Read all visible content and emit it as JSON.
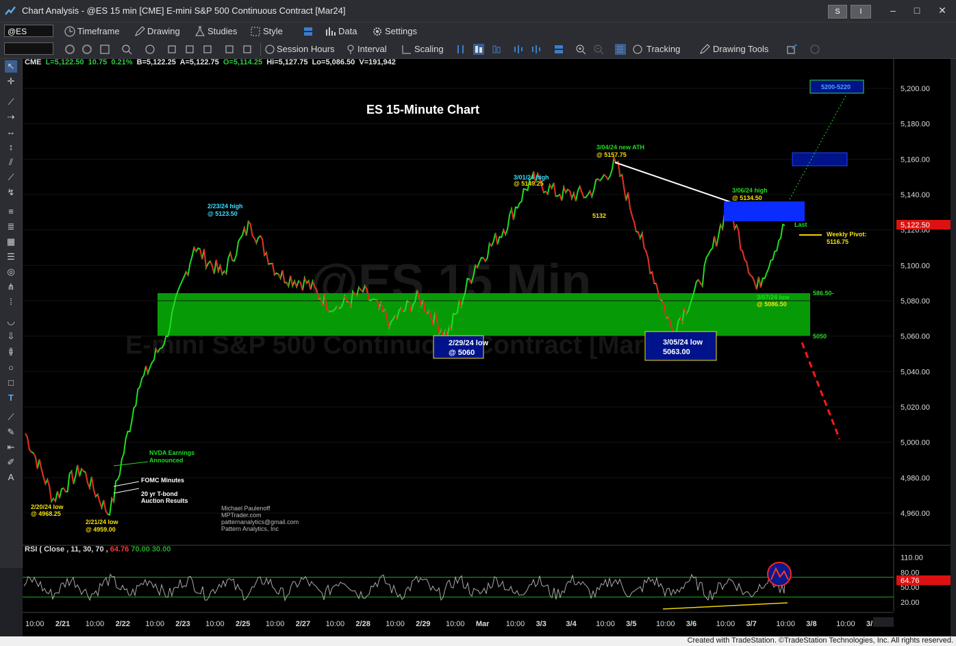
{
  "window": {
    "title": "Chart Analysis - @ES 15 min [CME] E-mini S&P 500 Continuous Contract [Mar24]",
    "btn_s": "S",
    "btn_i": "I",
    "ctl_min": "–",
    "ctl_max": "□",
    "ctl_close": "✕"
  },
  "toolbar1": {
    "symbol": "@ES",
    "timeframe": "Timeframe",
    "drawing": "Drawing",
    "studies": "Studies",
    "style": "Style",
    "data": "Data",
    "settings": "Settings"
  },
  "toolbar2": {
    "session_hours": "Session Hours",
    "interval": "Interval",
    "scaling": "Scaling",
    "tracking": "Tracking",
    "drawing_tools": "Drawing Tools"
  },
  "ohlc": {
    "exchange": "CME",
    "last": "L=5,122.50",
    "change": "10.75",
    "pct": "0.21%",
    "bid": "B=5,122.25",
    "ask": "A=5,122.75",
    "open": "O=5,114.25",
    "high": "Hi=5,127.75",
    "low": "Lo=5,086.50",
    "volume": "V=191,942"
  },
  "watermark": {
    "line1": "@ES 15 Min",
    "line2": "E-mini S&P 500 Continuous Contract [Mar24]"
  },
  "chart_title": "ES 15-Minute Chart",
  "annotations": {
    "ath_1": "3/04/24 new ATH",
    "ath_2": "@ 5157.75",
    "h301_1": "3/01/24 high",
    "h301_2": "@ 5149.25",
    "h223_1": "2/23/24 high",
    "h223_2": "@ 5123.50",
    "h306_1": "3/06/24 high",
    "h306_2": "@ 5134.50",
    "lvl5132": "5132",
    "last": "Last",
    "pivot_1": "Weekly Pivot:",
    "pivot_2": "5116.75",
    "l307_1": "3/07/24 low",
    "l307_2": "@ 5086.50",
    "z_top": "586.50-",
    "z_bot": "5050",
    "box229_1": "2/29/24 low",
    "box229_2": "@ 5060",
    "box305_1": "3/05/24 low",
    "box305_2": "5063.00",
    "target": "5200-5220",
    "nvda_1": "NVDA Earnings",
    "nvda_2": "Announced",
    "fomc": "FOMC Minutes",
    "tbond_1": "20 yr T-bond",
    "tbond_2": "Auction Results",
    "l220_1": "2/20/24 low",
    "l220_2": "@ 4968.25",
    "l221_1": "2/21/24 low",
    "l221_2": "@ 4959.00",
    "credit_1": "Michael Paulenoff",
    "credit_2": "MPTrader.com",
    "credit_3": "patternanalytics@gmail.com",
    "credit_4": "Pattern Analytics, Inc"
  },
  "price_axis": {
    "ticks": [
      "5,200.00",
      "5,180.00",
      "5,160.00",
      "5,140.00",
      "5,120.00",
      "5,100.00",
      "5,080.00",
      "5,060.00",
      "5,040.00",
      "5,020.00",
      "5,000.00",
      "4,980.00",
      "4,960.00"
    ],
    "tick_values": [
      5200,
      5180,
      5160,
      5140,
      5120,
      5100,
      5080,
      5060,
      5040,
      5020,
      5000,
      4980,
      4960
    ],
    "last_label": "5,122.50"
  },
  "rsi": {
    "label": "RSI ( Close , 11, 30, 70 ,",
    "value": "64.76",
    "ob": "70.00",
    "os": "30.00",
    "ticks": [
      "110.00",
      "80.00",
      "50.00",
      "20.00"
    ],
    "tick_values": [
      110,
      80,
      50,
      20
    ],
    "last_label": "64.76"
  },
  "time_axis": {
    "labels": [
      "10:00",
      "2/21",
      "10:00",
      "2/22",
      "10:00",
      "2/23",
      "10:00",
      "2/25",
      "10:00",
      "2/27",
      "10:00",
      "2/28",
      "10:00",
      "2/29",
      "10:00",
      "Mar",
      "10:00",
      "3/3",
      "3/4",
      "10:00",
      "3/5",
      "10:00",
      "3/6",
      "10:00",
      "3/7",
      "10:00",
      "3/8",
      "10:00",
      "3/10"
    ],
    "bold": [
      "2/21",
      "2/22",
      "2/23",
      "2/25",
      "2/27",
      "2/28",
      "2/29",
      "Mar",
      "3/3",
      "3/4",
      "3/5",
      "3/6",
      "3/7",
      "3/8",
      "3/10"
    ]
  },
  "chart_data": {
    "type": "line",
    "x": [
      "2/20 10:00",
      "2/20",
      "2/21",
      "2/21 10:00",
      "2/21 late",
      "2/22",
      "2/22 10:00",
      "2/23",
      "2/23 10:00",
      "2/25",
      "2/26",
      "2/27",
      "2/27 10:00",
      "2/28",
      "2/28 10:00",
      "2/29",
      "2/29 10:00",
      "Mar",
      "3/1 10:00",
      "3/3",
      "3/4",
      "3/4 10:00",
      "3/5",
      "3/5 10:00",
      "3/6",
      "3/6 10:00",
      "3/7",
      "3/7 late"
    ],
    "values": [
      5005,
      4968.25,
      4985,
      4959,
      5030,
      5060,
      5110,
      5095,
      5123.5,
      5095,
      5090,
      5075,
      5085,
      5068,
      5082,
      5060,
      5100,
      5120,
      5149.25,
      5140,
      5140,
      5157.75,
      5110,
      5063,
      5090,
      5134.5,
      5086.5,
      5122.5
    ],
    "ylim": [
      4950,
      5215
    ],
    "annotations": {
      "resistance_box": [
        5122,
        5135
      ],
      "target_box": [
        5158,
        5165
      ],
      "support_zone": [
        5060,
        5085
      ],
      "weekly_pivot": 5116.75
    },
    "rsi": {
      "params": "Close, 11, 30, 70",
      "last": 64.76,
      "overbought": 70,
      "oversold": 30,
      "ylim": [
        10,
        115
      ]
    }
  },
  "status": "Created with TradeStation. ©TradeStation Technologies, Inc. All rights reserved."
}
